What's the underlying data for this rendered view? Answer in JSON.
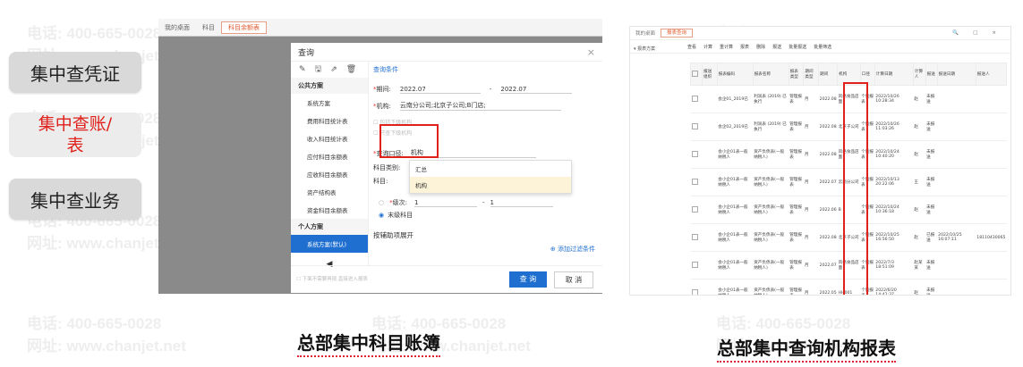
{
  "watermark": {
    "phone": "电话: 400-665-0028",
    "site": "网址: www.chanjet.net"
  },
  "side_menu": [
    {
      "label": "集中查凭证",
      "active": false
    },
    {
      "label": "集中查账/表",
      "active": true
    },
    {
      "label": "集中查业务",
      "active": false
    }
  ],
  "screen1": {
    "tabs": [
      "我的桌面",
      "科目",
      "科目余额表"
    ],
    "dialog": {
      "title": "查询",
      "close": "×",
      "side_icons": [
        "✎",
        "🖫",
        "⇗",
        "🗑"
      ],
      "public_section": "公共方案",
      "public_items": [
        "系统方案",
        "费用科目统计表",
        "收入科目统计表",
        "应付科目余额表",
        "应收科目余额表",
        "资产结构表",
        "资金科目余额表"
      ],
      "personal_section": "个人方案",
      "personal_items": [
        "系统方案(默认)"
      ],
      "query_conditions": "查询条件",
      "period_label": "期间:",
      "period_from": "2022.07",
      "period_to": "2022.07",
      "org_label": "机构:",
      "org_value": "云南分公司;北京子公司;B门店;",
      "check1": "包括下级机构",
      "check2": "只查下级机构",
      "caliber_label": "查询口径:",
      "caliber_value": "机构",
      "subject_type_label": "科目类别:",
      "subject_label": "科目:",
      "dropdown_options": [
        "汇总",
        "机构"
      ],
      "level_label": "级次:",
      "level_from": "1",
      "level_to": "1",
      "last_level": "末级科目",
      "aux_expand": "按辅助项展开",
      "add_filter": "添加过滤条件",
      "footer_hint": "下面不需要再按,直接进入报表",
      "query_button": "查 询",
      "cancel_button": "取 消"
    },
    "caption": "总部集中科目账簿"
  },
  "screen2": {
    "tabs": [
      "我的桌面",
      "报表查询"
    ],
    "toolbar": [
      "查看",
      "计算",
      "重计算",
      "报表",
      "删除",
      "报送",
      "批量报送",
      "批量筛选"
    ],
    "tree_root": "报表方案",
    "headers": [
      "报送组织",
      "报表编码",
      "报表名称",
      "报表类型",
      "期间类型",
      "期间",
      "机构",
      "口径",
      "计算日期",
      "计算人",
      "报送",
      "报送日期",
      "报送人"
    ],
    "rows": [
      [
        "",
        "会企01_2019已",
        "利润表 (2019) 已执行",
        "管理报表",
        "月",
        "2022.08",
        "风格食品店面",
        "个别报表",
        "2022/10/26 10:28:34",
        "赵",
        "未报送",
        "",
        ""
      ],
      [
        "",
        "会企02_2019已",
        "利润表 (2019) 已执行",
        "管理报表",
        "月",
        "2022.08",
        "北京子公司",
        "个别报表",
        "2022/10/26 11:03:26",
        "赵",
        "未报送",
        "",
        ""
      ],
      [
        "",
        "会小企01表一般纳税人",
        "资产负债表(一般纳税人)",
        "管理报表",
        "月",
        "2022.08",
        "风格食品店面",
        "个别报表",
        "2022/10/24 10:40:20",
        "赵",
        "未报送",
        "",
        ""
      ],
      [
        "",
        "会小企01表一般纳税人",
        "资产负债表(一般纳税人)",
        "管理报表",
        "月",
        "2022.07",
        "云南分公司",
        "个别报表",
        "2022/10/13 20:22:06",
        "王",
        "未报送",
        "",
        ""
      ],
      [
        "",
        "会小企01表一般纳税人",
        "资产负债表(一般纳税人)",
        "管理报表",
        "月",
        "2022.06",
        "B",
        "个别报表",
        "2022/10/24 10:36:18",
        "赵",
        "未报送",
        "",
        ""
      ],
      [
        "",
        "会小企01表一般纳税人",
        "资产负债表(一般纳税人)",
        "管理报表",
        "月",
        "2022.08",
        "北京子公司",
        "个别报表",
        "2022/10/25 16:56:50",
        "赵",
        "已报送",
        "2022/10/25 16:07:11",
        "18110430065"
      ],
      [
        "",
        "会小企01表一般纳税人",
        "资产负债表(一般纳税人)",
        "管理报表",
        "月",
        "2022.07",
        "风格食品店面",
        "个别报表",
        "2022/7/3 18:51:09",
        "赵某某",
        "未报送",
        "",
        ""
      ],
      [
        "",
        "会小企01表一般纳税人",
        "资产负债表(一般纳税人)",
        "管理报表",
        "月",
        "2022.05",
        "HH001",
        "个别报表",
        "2022/6/20 14:42:37",
        "赵",
        "未报送",
        "",
        ""
      ]
    ],
    "window_icons": [
      "🔍",
      "□",
      "×"
    ],
    "caption": "总部集中查询机构报表"
  },
  "colors": {
    "accent": "#e0201a",
    "primary": "#1f6fd0"
  }
}
